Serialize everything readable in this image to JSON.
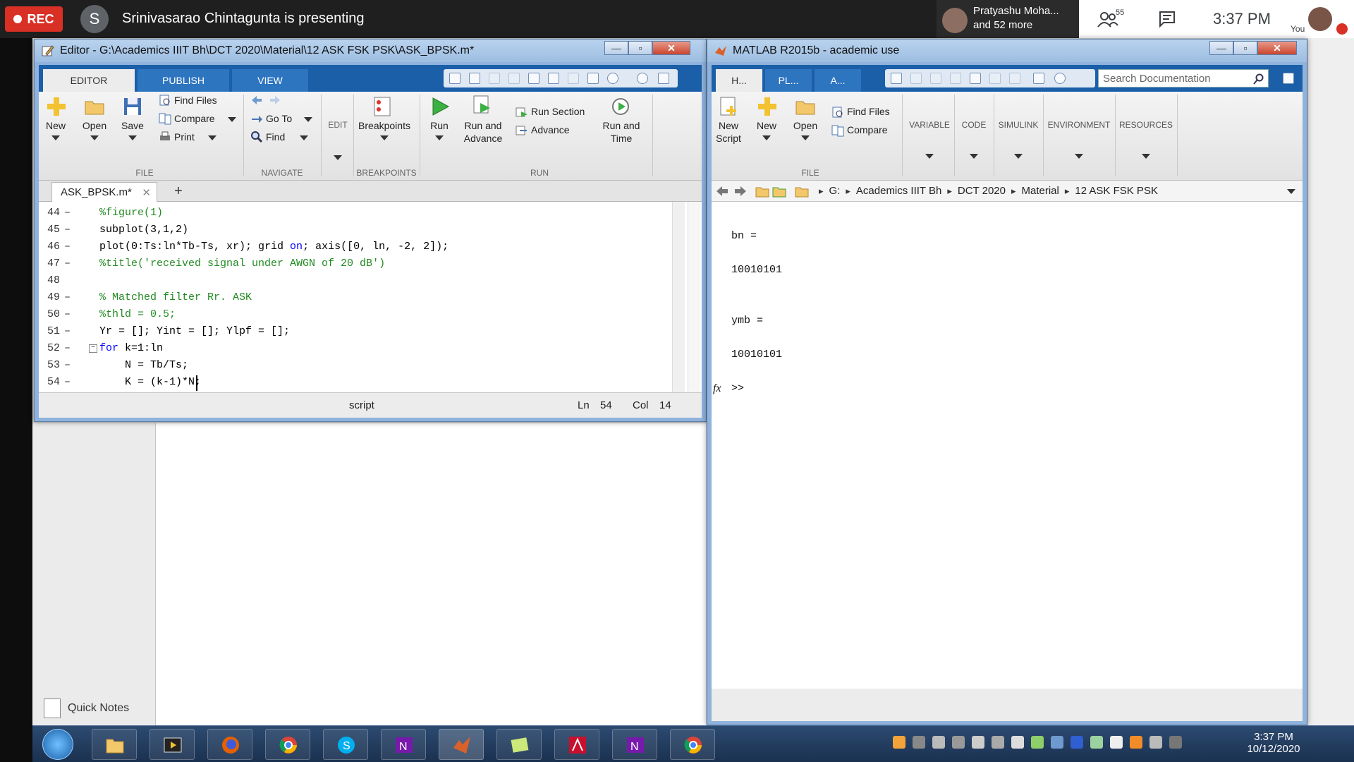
{
  "meet": {
    "rec_label": "REC",
    "presenter_initial": "S",
    "presenter_text": "Srinivasarao Chintagunta is presenting",
    "participant_name": "Pratyashu Moha...",
    "participant_more": "and 52 more",
    "people_count": "55",
    "time": "3:37 PM",
    "you_label": "You"
  },
  "editor": {
    "title": "Editor - G:\\Academics IIIT Bh\\DCT 2020\\Material\\12 ASK FSK PSK\\ASK_BPSK.m*",
    "tabs": [
      "EDITOR",
      "PUBLISH",
      "VIEW"
    ],
    "file_group": {
      "new": "New",
      "open": "Open",
      "save": "Save",
      "find_files": "Find Files",
      "compare": "Compare",
      "print": "Print",
      "label": "FILE"
    },
    "navigate_group": {
      "go_to": "Go To",
      "find": "Find",
      "label": "NAVIGATE"
    },
    "edit_label": "EDIT",
    "breakpoints_group": {
      "breakpoints": "Breakpoints",
      "label": "BREAKPOINTS"
    },
    "run_group": {
      "run": "Run",
      "run_and_advance_1": "Run and",
      "run_and_advance_2": "Advance",
      "run_section": "Run Section",
      "advance": "Advance",
      "run_and_time_1": "Run and",
      "run_and_time_2": "Time",
      "label": "RUN"
    },
    "doc_tab": "ASK_BPSK.m*",
    "code_lines": [
      {
        "num": "44",
        "text": "%figure(1)"
      },
      {
        "num": "45",
        "text": "subplot(3,1,2)"
      },
      {
        "num": "46",
        "pre": "plot(0:Ts:ln*Tb-Ts, xr); grid ",
        "kw": "on",
        "post": "; axis([0, ln, -2, 2]);"
      },
      {
        "num": "47",
        "text": "%title('received signal under AWGN of 20 dB')"
      },
      {
        "num": "48",
        "text": ""
      },
      {
        "num": "49",
        "text": "% Matched filter Rr. ASK"
      },
      {
        "num": "50",
        "text": "%thld = 0.5;"
      },
      {
        "num": "51",
        "text": "Yr = []; Yint = []; Ylpf = [];"
      },
      {
        "num": "52",
        "kw": "for",
        "post": " k=1:ln"
      },
      {
        "num": "53",
        "text": "    N = Tb/Ts;"
      },
      {
        "num": "54",
        "text": "    K = (k-1)*N;"
      }
    ],
    "status": {
      "mode": "script",
      "ln_label": "Ln",
      "ln": "54",
      "col_label": "Col",
      "col": "14"
    }
  },
  "matlab": {
    "title": "MATLAB R2015b - academic use",
    "tabs": [
      "H...",
      "PL...",
      "A..."
    ],
    "search_placeholder": "Search Documentation",
    "file_group": {
      "new_script_1": "New",
      "new_script_2": "Script",
      "new": "New",
      "open": "Open",
      "find_files": "Find Files",
      "compare": "Compare",
      "label": "FILE"
    },
    "sections": [
      "VARIABLE",
      "CODE",
      "SIMULINK",
      "ENVIRONMENT",
      "RESOURCES"
    ],
    "path": [
      "G:",
      "Academics IIIT Bh",
      "DCT 2020",
      "Material",
      "12 ASK FSK PSK"
    ],
    "output": [
      "bn =",
      "10010101",
      "ymb =",
      "10010101"
    ],
    "prompt": ">>",
    "fx": "fx"
  },
  "desktop": {
    "quick_notes": "Quick Notes"
  },
  "taskbar": {
    "time": "3:37 PM",
    "date": "10/12/2020"
  }
}
